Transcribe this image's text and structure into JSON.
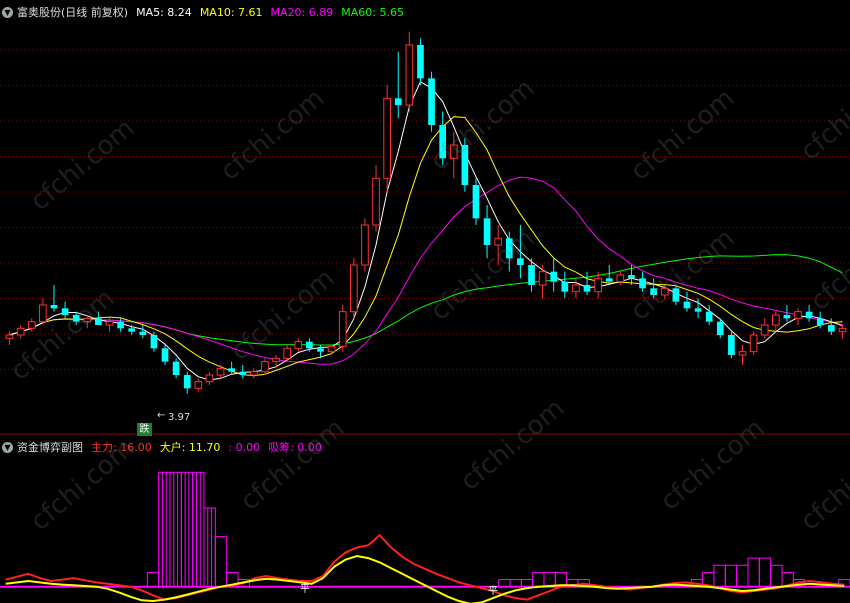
{
  "main": {
    "title": "富奥股份(日线 前复权)",
    "ma": [
      {
        "label": "MA5: 8.24",
        "color": "#ffffff"
      },
      {
        "label": "MA10: 7.61",
        "color": "#ffff00"
      },
      {
        "label": "MA20: 6.89",
        "color": "#ff00ff"
      },
      {
        "label": "MA60: 5.65",
        "color": "#00ff00"
      }
    ],
    "low_label": "3.97",
    "low_arrow": "←",
    "die_badge": "跌"
  },
  "sub": {
    "title": "资金博弈副图",
    "items": [
      {
        "label": "主力: 16.00",
        "color": "#ff3030"
      },
      {
        "label": "大户: 11.70",
        "color": "#ffff00"
      },
      {
        "label": ": 0.00",
        "color": "#ff00ff"
      },
      {
        "label": "吸筹: 0.00",
        "color": "#ff00ff"
      }
    ],
    "ping_marks": [
      "平",
      "平"
    ]
  },
  "watermark": "cfchi.com",
  "colors": {
    "up": "#ff3030",
    "down": "#00ffff",
    "grid": "#8b0000",
    "ma5": "#ffffff",
    "ma10": "#ffff00",
    "ma20": "#ff00ff",
    "ma60": "#00ff00"
  },
  "chart_data": {
    "type": "candlestick",
    "y_range": [
      3.5,
      9.5
    ],
    "candles": [
      [
        4.8,
        4.9,
        4.7,
        4.85
      ],
      [
        4.85,
        5.0,
        4.8,
        4.95
      ],
      [
        4.95,
        5.1,
        4.9,
        5.05
      ],
      [
        5.05,
        5.4,
        5.0,
        5.3
      ],
      [
        5.3,
        5.6,
        5.2,
        5.25
      ],
      [
        5.25,
        5.35,
        5.1,
        5.15
      ],
      [
        5.15,
        5.2,
        5.0,
        5.05
      ],
      [
        5.05,
        5.15,
        4.95,
        5.1
      ],
      [
        5.1,
        5.2,
        5.0,
        5.0
      ],
      [
        5.0,
        5.1,
        4.9,
        5.05
      ],
      [
        5.05,
        5.1,
        4.9,
        4.95
      ],
      [
        4.95,
        5.0,
        4.85,
        4.9
      ],
      [
        4.9,
        5.0,
        4.8,
        4.85
      ],
      [
        4.85,
        4.9,
        4.6,
        4.65
      ],
      [
        4.65,
        4.7,
        4.4,
        4.45
      ],
      [
        4.45,
        4.5,
        4.2,
        4.25
      ],
      [
        4.25,
        4.3,
        3.97,
        4.05
      ],
      [
        4.05,
        4.2,
        4.0,
        4.15
      ],
      [
        4.15,
        4.3,
        4.1,
        4.25
      ],
      [
        4.25,
        4.4,
        4.2,
        4.35
      ],
      [
        4.35,
        4.45,
        4.25,
        4.3
      ],
      [
        4.3,
        4.4,
        4.2,
        4.25
      ],
      [
        4.25,
        4.35,
        4.2,
        4.3
      ],
      [
        4.3,
        4.5,
        4.25,
        4.45
      ],
      [
        4.45,
        4.55,
        4.35,
        4.5
      ],
      [
        4.5,
        4.7,
        4.45,
        4.65
      ],
      [
        4.65,
        4.8,
        4.6,
        4.75
      ],
      [
        4.75,
        4.8,
        4.6,
        4.65
      ],
      [
        4.65,
        4.7,
        4.5,
        4.6
      ],
      [
        4.6,
        4.7,
        4.55,
        4.68
      ],
      [
        4.68,
        5.3,
        4.6,
        5.2
      ],
      [
        5.2,
        6.0,
        5.1,
        5.9
      ],
      [
        5.9,
        6.6,
        5.8,
        6.5
      ],
      [
        6.5,
        7.4,
        6.4,
        7.2
      ],
      [
        7.2,
        8.6,
        7.0,
        8.4
      ],
      [
        8.4,
        9.1,
        8.1,
        8.3
      ],
      [
        8.3,
        9.4,
        8.2,
        9.2
      ],
      [
        9.2,
        9.3,
        8.6,
        8.7
      ],
      [
        8.7,
        8.8,
        7.9,
        8.0
      ],
      [
        8.0,
        8.2,
        7.4,
        7.5
      ],
      [
        7.5,
        7.9,
        7.2,
        7.7
      ],
      [
        7.7,
        7.8,
        7.0,
        7.1
      ],
      [
        7.1,
        7.2,
        6.5,
        6.6
      ],
      [
        6.6,
        6.8,
        6.0,
        6.2
      ],
      [
        6.2,
        6.5,
        5.9,
        6.3
      ],
      [
        6.3,
        6.4,
        5.8,
        6.0
      ],
      [
        6.0,
        6.5,
        5.7,
        5.9
      ],
      [
        5.9,
        6.0,
        5.5,
        5.6
      ],
      [
        5.6,
        5.9,
        5.4,
        5.8
      ],
      [
        5.8,
        6.0,
        5.5,
        5.65
      ],
      [
        5.65,
        5.8,
        5.4,
        5.5
      ],
      [
        5.5,
        5.7,
        5.4,
        5.6
      ],
      [
        5.6,
        5.8,
        5.45,
        5.5
      ],
      [
        5.5,
        5.8,
        5.4,
        5.7
      ],
      [
        5.7,
        5.9,
        5.6,
        5.65
      ],
      [
        5.65,
        5.8,
        5.6,
        5.75
      ],
      [
        5.75,
        5.9,
        5.6,
        5.7
      ],
      [
        5.7,
        5.8,
        5.5,
        5.55
      ],
      [
        5.55,
        5.7,
        5.4,
        5.45
      ],
      [
        5.45,
        5.6,
        5.4,
        5.55
      ],
      [
        5.55,
        5.6,
        5.3,
        5.35
      ],
      [
        5.35,
        5.5,
        5.2,
        5.25
      ],
      [
        5.25,
        5.4,
        5.1,
        5.2
      ],
      [
        5.2,
        5.3,
        5.0,
        5.05
      ],
      [
        5.05,
        5.1,
        4.8,
        4.85
      ],
      [
        4.85,
        4.9,
        4.5,
        4.55
      ],
      [
        4.55,
        4.7,
        4.4,
        4.6
      ],
      [
        4.6,
        4.9,
        4.55,
        4.85
      ],
      [
        4.85,
        5.1,
        4.8,
        5.0
      ],
      [
        5.0,
        5.2,
        4.9,
        5.15
      ],
      [
        5.15,
        5.3,
        5.05,
        5.1
      ],
      [
        5.1,
        5.25,
        5.0,
        5.2
      ],
      [
        5.2,
        5.3,
        5.05,
        5.1
      ],
      [
        5.1,
        5.2,
        4.95,
        5.0
      ],
      [
        5.0,
        5.1,
        4.85,
        4.9
      ],
      [
        4.9,
        5.0,
        4.8,
        4.95
      ]
    ]
  },
  "sub_data": {
    "y_range": [
      -2,
      18
    ],
    "bars": [
      0,
      0,
      0,
      0,
      0,
      0,
      0,
      0,
      0,
      0,
      0,
      0,
      0,
      2,
      16,
      16,
      16,
      16,
      11,
      7,
      2,
      1,
      0,
      0,
      0,
      0,
      0,
      0,
      0,
      0,
      0,
      0,
      0,
      0,
      0,
      0,
      0,
      0,
      0,
      0,
      0,
      0,
      0,
      0,
      1,
      1,
      1,
      2,
      2,
      2,
      1,
      1,
      0,
      0,
      0,
      0,
      0,
      0,
      0,
      0,
      0,
      1,
      2,
      3,
      3,
      3,
      4,
      4,
      3,
      2,
      1,
      0,
      0,
      0,
      1
    ],
    "main_force": [
      1,
      1.4,
      1.8,
      1.2,
      0.8,
      1,
      1.2,
      0.9,
      0.6,
      0.4,
      0.2,
      0,
      -0.5,
      -1.2,
      -1.8,
      -1.6,
      -1.2,
      -0.8,
      -0.4,
      0,
      0.2,
      0.5,
      1.2,
      1.5,
      1.2,
      1,
      0.8,
      0.8,
      1.5,
      3.5,
      4.8,
      5.5,
      5.8,
      7.2,
      5.5,
      4.2,
      3.2,
      2.5,
      1.8,
      1.2,
      0.6,
      0.2,
      -0.2,
      -0.6,
      -1.2,
      -1.6,
      -1.8,
      -1.2,
      -0.6,
      0,
      0.2,
      0.4,
      0.2,
      0,
      -0.2,
      -0.4,
      -0.2,
      0,
      0.3,
      0.5,
      0.6,
      0.4,
      0.2,
      -0.2,
      -0.6,
      -0.8,
      -0.6,
      -0.4,
      -0.2,
      0.2,
      0.6,
      0.8,
      0.6,
      0.4,
      0.3
    ],
    "big_holder": [
      0.4,
      0.6,
      0.8,
      0.6,
      0.4,
      0.3,
      0.2,
      0.1,
      0,
      -0.3,
      -0.8,
      -1.4,
      -1.9,
      -2.0,
      -1.8,
      -1.5,
      -1.1,
      -0.7,
      -0.3,
      0,
      0.3,
      0.6,
      0.9,
      1.1,
      1.0,
      0.8,
      0.6,
      0.4,
      1.2,
      2.8,
      3.8,
      4.3,
      4.0,
      3.4,
      2.6,
      1.8,
      1.0,
      0.2,
      -0.6,
      -1.4,
      -2.0,
      -2.4,
      -2.2,
      -1.6,
      -1.0,
      -0.5,
      -0.2,
      0,
      0.1,
      0.2,
      0.2,
      0.1,
      0,
      -0.2,
      -0.3,
      -0.2,
      -0.1,
      0,
      0.2,
      0.3,
      0.2,
      0.1,
      0,
      -0.2,
      -0.4,
      -0.6,
      -0.5,
      -0.3,
      -0.1,
      0.1,
      0.3,
      0.4,
      0.3,
      0.2,
      0.1
    ]
  }
}
